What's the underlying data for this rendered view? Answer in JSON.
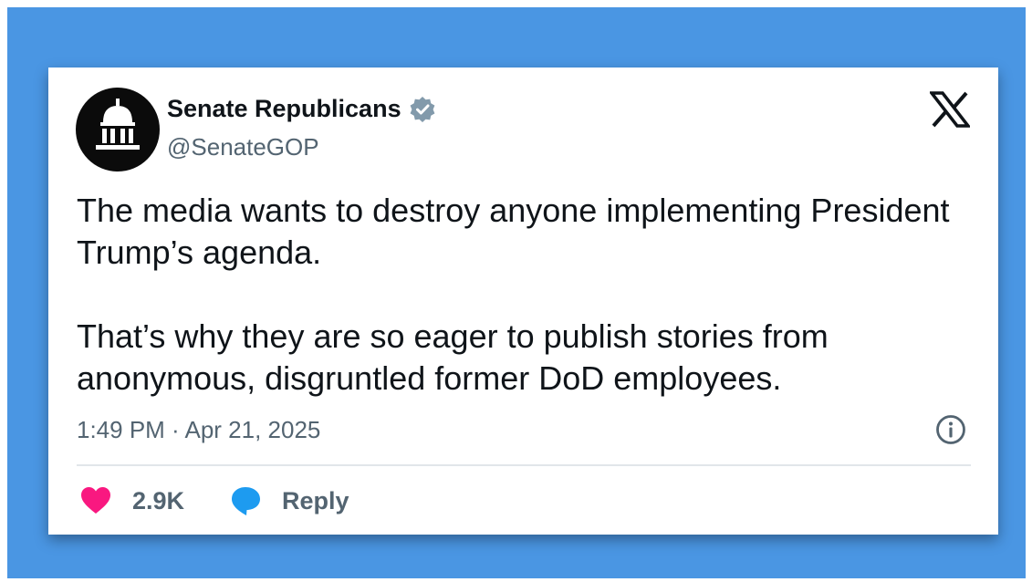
{
  "account": {
    "name": "Senate Republicans",
    "handle": "@SenateGOP",
    "verified": true,
    "avatar_icon": "capitol-building-icon"
  },
  "brand": {
    "logo_icon": "x-logo-icon",
    "color": "#0f1419"
  },
  "tweet": {
    "paragraph_1": "The media wants to destroy anyone implementing President Trump’s agenda.",
    "paragraph_2": "That’s why they are so eager to publish stories from anonymous, disgruntled former DoD employees.",
    "timestamp": "1:49 PM · Apr 21, 2025"
  },
  "actions": {
    "likes_count": "2.9K",
    "reply_label": "Reply"
  },
  "colors": {
    "background": "#4a96e3",
    "heart": "#f91880",
    "reply_bubble": "#1d9bf0",
    "verified_badge": "#829aab",
    "secondary_text": "#536471"
  }
}
